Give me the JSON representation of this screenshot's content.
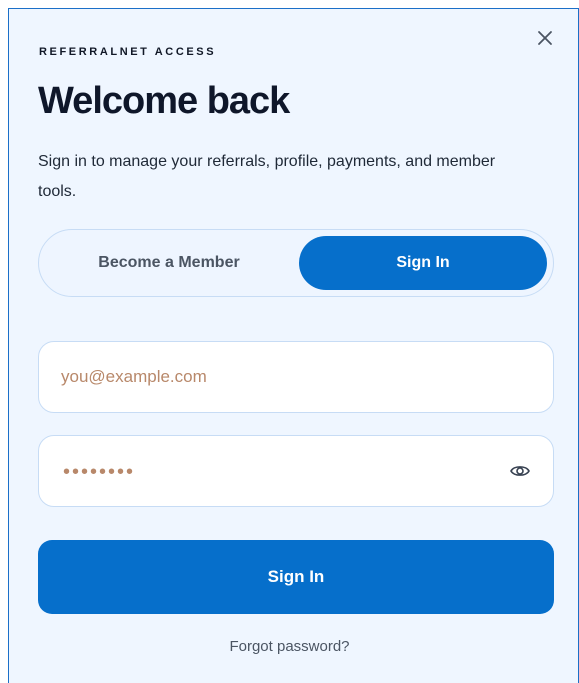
{
  "header": {
    "eyebrow": "REFERRALNET ACCESS",
    "title": "Welcome back",
    "subtitle": "Sign in to manage your referrals, profile, payments, and member tools.",
    "close_icon": "close-icon"
  },
  "toggle": {
    "options": [
      {
        "label": "Become a Member",
        "selected": false
      },
      {
        "label": "Sign In",
        "selected": true
      }
    ]
  },
  "form": {
    "email_placeholder": "you@example.com",
    "email_value": "",
    "password_masked": "••••••••",
    "password_toggle_icon": "eye-icon",
    "submit_label": "Sign In",
    "forgot_label": "Forgot password?"
  },
  "colors": {
    "accent": "#066fcb",
    "panel_bg": "#eff6ff",
    "placeholder": "#b8886a"
  }
}
